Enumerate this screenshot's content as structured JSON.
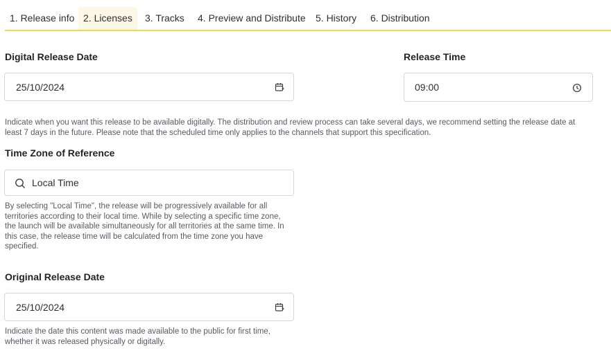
{
  "tabs": [
    {
      "label": "1. Release info"
    },
    {
      "label": "2. Licenses"
    },
    {
      "label": "3. Tracks"
    },
    {
      "label": "4. Preview and Distribute"
    },
    {
      "label": "5. History"
    },
    {
      "label": "6. Distribution"
    }
  ],
  "active_tab": "2. Licenses",
  "digital_release": {
    "label": "Digital Release Date",
    "value": "25/10/2024",
    "icon": "calendar-icon"
  },
  "release_time": {
    "label": "Release Time",
    "value": "09:00",
    "icon": "clock-icon"
  },
  "digital_help": "Indicate when you want this release to be available digitally. The distribution and review process can take several days, we recommend setting the release date at least 7 days in the future. Please note that the scheduled time only applies to the channels that support this specification.",
  "timezone": {
    "label": "Time Zone of Reference",
    "value": "Local Time",
    "icon": "search-icon"
  },
  "timezone_help": "By selecting \"Local Time\", the release will be progressively available for all territories according to their local time. While by selecting a specific time zone, the launch will be available simultaneously for all territories at the same time. In this case, the release time will be calculated from the time zone you have specified.",
  "original_release": {
    "label": "Original Release Date",
    "value": "25/10/2024",
    "icon": "calendar-icon"
  },
  "original_help": "Indicate the date this content was made available to the public for first time, whether it was released physically or digitally.",
  "colors": {
    "accent": "#f2d64b",
    "active_tab_bg": "#fdf8e6",
    "border": "#d3d6db",
    "help_text": "#555b62"
  }
}
